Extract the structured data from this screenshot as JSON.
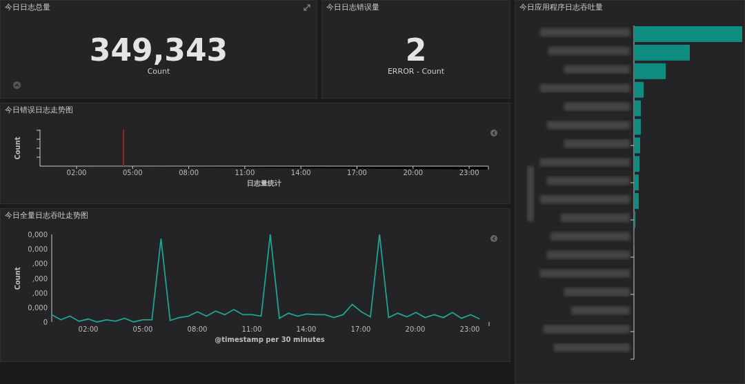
{
  "total_panel": {
    "title": "今日日志总量",
    "value": "349,343",
    "label": "Count"
  },
  "error_panel": {
    "title": "今日日志错误量",
    "value": "2",
    "label": "ERROR - Count"
  },
  "error_trend": {
    "title": "今日错误日志走势图",
    "ylabel": "Count",
    "xticks": [
      "02:00",
      "05:00",
      "08:00",
      "11:00",
      "14:00",
      "17:00",
      "20:00",
      "23:00"
    ],
    "xlabel": "日志量统计"
  },
  "throughput_trend": {
    "title": "今日全量日志吞吐走势图",
    "ylabel": "Count",
    "yticks": [
      "0,000",
      "0,000",
      ",000",
      ",000",
      ",000",
      "0,000",
      "0"
    ],
    "xticks": [
      "02:00",
      "05:00",
      "08:00",
      "11:00",
      "14:00",
      "17:00",
      "20:00",
      "23:00"
    ],
    "xlabel": "@timestamp per 30 minutes"
  },
  "app_throughput": {
    "title": "今日应用程序日志吞吐量"
  }
}
